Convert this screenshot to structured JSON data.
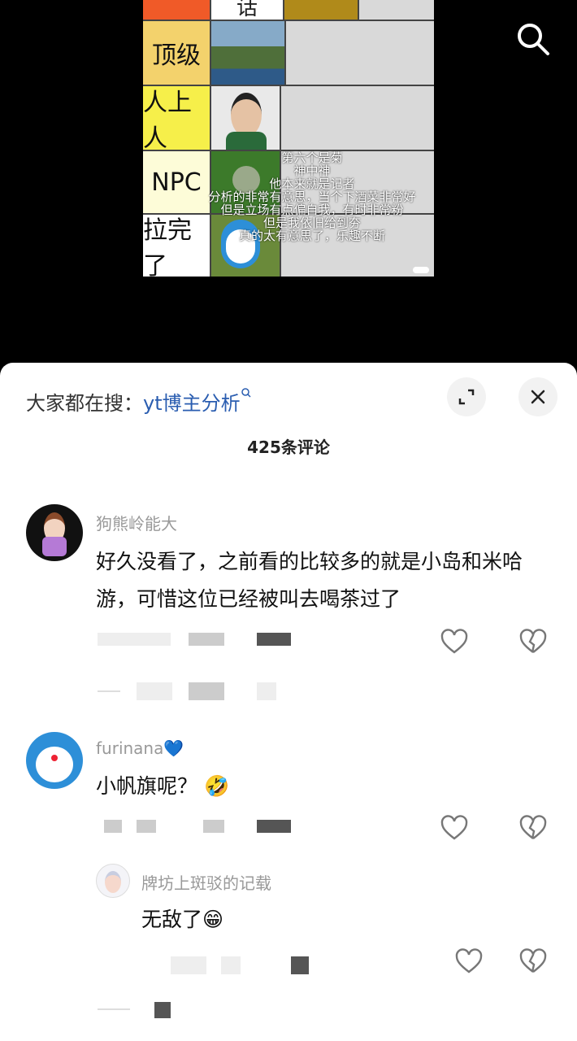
{
  "tier_list": {
    "rows": [
      {
        "label": ""
      },
      {
        "label": "顶级"
      },
      {
        "label": "人上人"
      },
      {
        "label": "NPC"
      },
      {
        "label": "拉完了"
      }
    ],
    "top_cell_char": "话",
    "overlay_lines": [
      "第六个是菊",
      "神中神",
      "他本来就是记者",
      "分析的非常有意思，当个下酒菜非常好",
      "但是立场有点偏自我，有时非常粉",
      "但是我依旧给到夯",
      "真的太有意思了，乐趣不断"
    ]
  },
  "comments_sheet": {
    "search_prefix": "大家都在搜：",
    "search_keyword": "yt博主分析",
    "count_label": "425条评论",
    "comments": [
      {
        "user": "狗熊岭能大",
        "text": "好久没看了，之前看的比较多的就是小岛和米哈游，可惜这位已经被叫去喝茶过了"
      },
      {
        "user": "furinana💙",
        "text": "小帆旗呢？ 🤣"
      },
      {
        "user": "牌坊上斑驳的记载",
        "text": "无敌了😁"
      }
    ]
  },
  "colors": {
    "accent": "#2a5db0",
    "tier_top": "#f05a28",
    "tier_s": "#f3d26c",
    "tier_a": "#f6ef4a",
    "tier_npc": "#fdfcd8",
    "tier_end": "#ffffff"
  },
  "icons": [
    "search-icon",
    "expand-icon",
    "close-icon",
    "heart-icon",
    "broken-heart-icon"
  ]
}
